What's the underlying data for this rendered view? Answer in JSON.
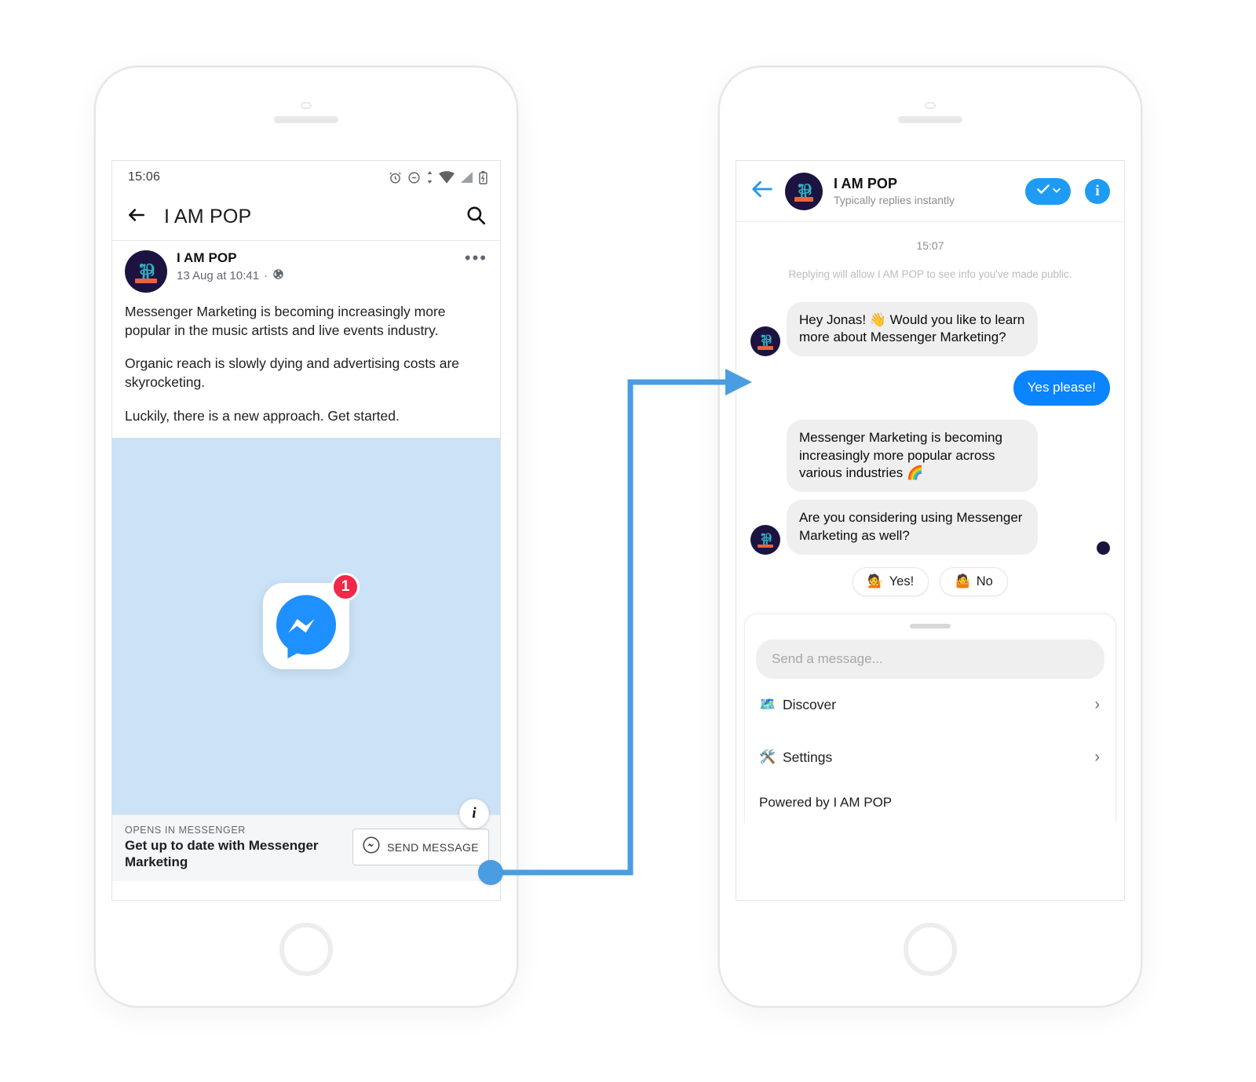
{
  "left_phone": {
    "status_bar": {
      "time": "15:06",
      "icons": [
        "alarm-icon",
        "do-not-disturb-icon",
        "sync-icon",
        "wifi-icon",
        "cellular-signal-icon",
        "battery-charging-icon"
      ]
    },
    "app_bar": {
      "back_icon": "back-arrow-icon",
      "title": "I AM POP",
      "search_icon": "search-icon"
    },
    "post": {
      "author": "I AM POP",
      "timestamp": "13 Aug at 10:41",
      "privacy_icon": "globe-icon",
      "privacy_separator": "·",
      "more_label": "•••",
      "paragraphs": [
        "Messenger Marketing is becoming increasingly more popular in the music artists and live events industry.",
        "Organic reach is slowly dying and advertising costs are skyrocketing.",
        "Luckily, there is a new approach. Get started."
      ],
      "image": {
        "background_color": "#cbe2f7",
        "icon": "messenger-app-icon",
        "badge_count": "1",
        "info_label": "i"
      },
      "cta": {
        "kicker": "OPENS IN MESSENGER",
        "title": "Get up to date with Messenger Marketing",
        "button_label": "SEND MESSAGE",
        "button_icon": "messenger-icon"
      }
    }
  },
  "right_phone": {
    "header": {
      "back_icon": "back-arrow-icon",
      "name": "I AM POP",
      "subtitle": "Typically replies instantly",
      "verified_label": "check-chevron-badge",
      "info_label": "i"
    },
    "thread": {
      "timestamp": "15:07",
      "disclaimer": "Replying will allow I AM POP to see info you've made public.",
      "messages": [
        {
          "from": "bot",
          "text": "Hey Jonas! 👋 Would you like to learn more about Messenger Marketing?",
          "avatar": true
        },
        {
          "from": "user",
          "text": "Yes please!"
        },
        {
          "from": "bot",
          "text": "Messenger Marketing is becoming increasingly more popular across various industries 🌈",
          "avatar": false
        },
        {
          "from": "bot",
          "text": "Are you considering using Messenger Marketing as well?",
          "avatar": true,
          "seen": true
        }
      ],
      "quick_replies": [
        {
          "emoji": "💁",
          "label": "Yes!"
        },
        {
          "emoji": "🤷",
          "label": "No"
        }
      ]
    },
    "composer": {
      "placeholder": "Send a message..."
    },
    "menu": [
      {
        "emoji": "🗺️",
        "label": "Discover",
        "chevron": "›"
      },
      {
        "emoji": "🛠️",
        "label": "Settings",
        "chevron": "›"
      }
    ],
    "footer": "Powered by I AM POP"
  },
  "connector": {
    "color": "#4a9de0",
    "from": "send-message-button",
    "to": "first-bot-message"
  },
  "brand": {
    "messenger_blue": "#0a84ff",
    "facebook_blue": "#1e9bf5",
    "logo_navy": "#1d1340",
    "logo_teal": "#2fb3c4",
    "logo_orange": "#e8643c"
  }
}
